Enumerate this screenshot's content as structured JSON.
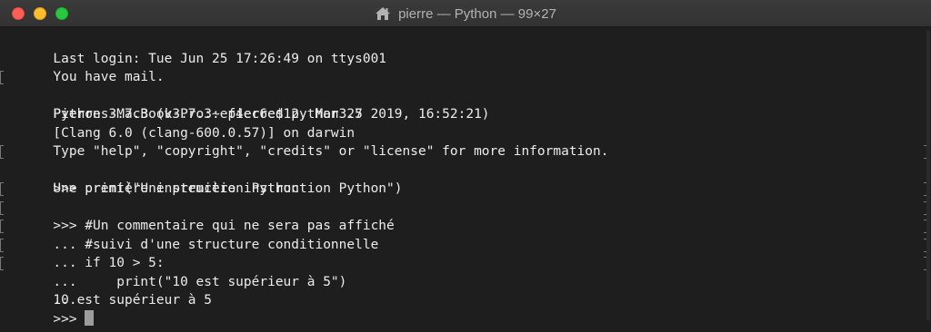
{
  "window": {
    "title": "pierre — Python — 99×27",
    "title_icon": "home-icon"
  },
  "terminal": {
    "lines": [
      "Last login: Tue Jun 25 17:26:49 on ttys001",
      "You have mail.",
      "Pierres-MacBook-Pro:~ pierre$ python3.7",
      "Python 3.7.3 (v3.7.3:ef4ec6ed12, Mar 25 2019, 16:52:21)",
      "[Clang 6.0 (clang-600.0.57)] on darwin",
      "Type \"help\", \"copyright\", \"credits\" or \"license\" for more information.",
      ">>> print(\"Une première instruction Python\")",
      "Une première instruction Python",
      ">>> #Un commentaire qui ne sera pas affiché",
      "... #suivi d'une structure conditionnelle",
      "... if 10 > 5:",
      "...     print(\"10 est supérieur à 5\")",
      "...",
      "10 est supérieur à 5",
      ">>> "
    ]
  },
  "colors": {
    "background": "#1e1e1e",
    "text": "#ececec",
    "close": "#fe5f57",
    "minimize": "#febc2e",
    "zoom": "#28c840"
  }
}
